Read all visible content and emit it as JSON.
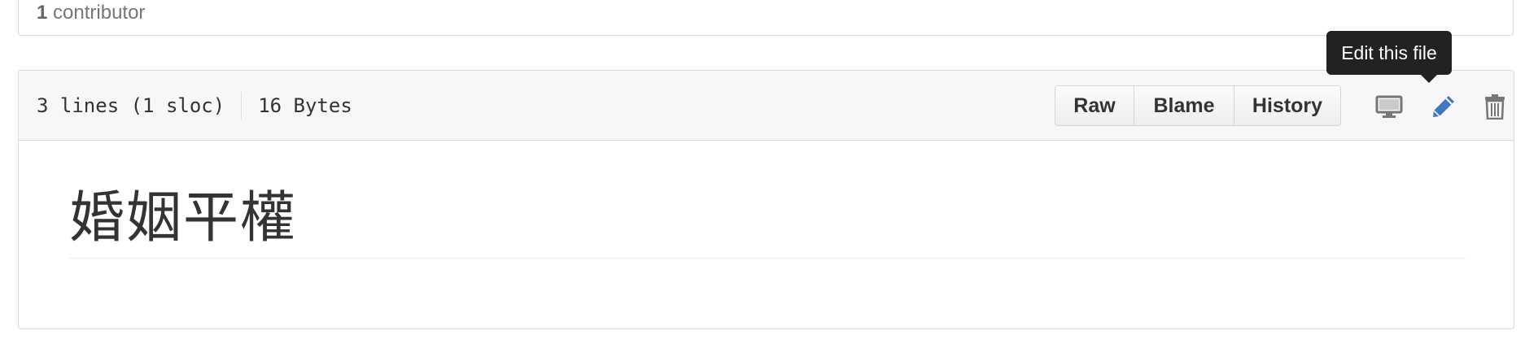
{
  "contributors": {
    "count": "1",
    "label": "contributor"
  },
  "file_header": {
    "lines": "3 lines (1 sloc)",
    "size": "16 Bytes",
    "buttons": {
      "raw": "Raw",
      "blame": "Blame",
      "history": "History"
    },
    "icons": {
      "desktop": "desktop-icon",
      "edit": "pencil-icon",
      "delete": "trash-icon"
    },
    "tooltip": "Edit this file",
    "colors": {
      "edit_icon": "#4078c0",
      "muted_icon": "#767676"
    }
  },
  "content": {
    "heading": "婚姻平權"
  }
}
